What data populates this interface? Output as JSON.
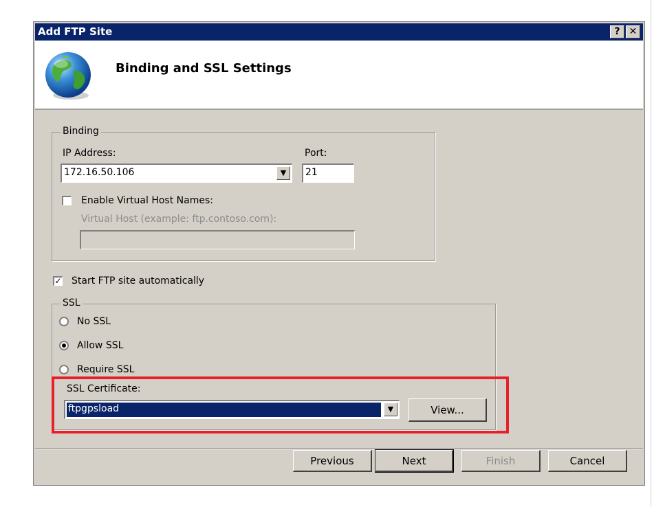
{
  "window": {
    "title": "Add FTP Site",
    "help_glyph": "?",
    "close_glyph": "✕"
  },
  "header": {
    "title": "Binding and SSL Settings",
    "icon": "globe-icon"
  },
  "binding": {
    "legend": "Binding",
    "ip_label": "IP Address:",
    "ip_value": "172.16.50.106",
    "port_label": "Port:",
    "port_value": "21",
    "enable_vhost_label": "Enable Virtual Host Names:",
    "enable_vhost_checked": false,
    "vhost_label": "Virtual Host (example: ftp.contoso.com):",
    "vhost_value": ""
  },
  "start_auto": {
    "label": "Start FTP site automatically",
    "checked": true
  },
  "ssl": {
    "legend": "SSL",
    "options": [
      "No SSL",
      "Allow SSL",
      "Require SSL"
    ],
    "selected": "Allow SSL",
    "cert_label": "SSL Certificate:",
    "cert_value": "ftpgpsload",
    "view_label": "View..."
  },
  "buttons": {
    "previous": "Previous",
    "next": "Next",
    "finish": "Finish",
    "cancel": "Cancel"
  },
  "colors": {
    "titlebar": "#0a246a",
    "face": "#d4d0c8",
    "highlight": "#e8202a"
  }
}
